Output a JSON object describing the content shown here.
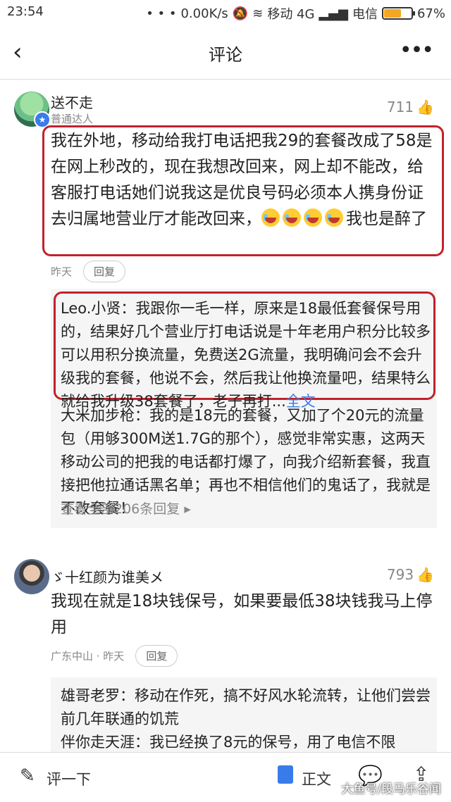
{
  "status": {
    "time": "23:54",
    "speed": "0.00K/s",
    "carrier1": "移动 4G",
    "carrier2": "电信",
    "battery": "67%",
    "battery_level": 0.67
  },
  "nav": {
    "title": "评论",
    "back_icon": "‹",
    "more_icon": "•••"
  },
  "comment1": {
    "user": "送不走",
    "level": "普通达人",
    "likes": "711",
    "text": "我在外地，移动给我打电话把我29的套餐改成了58是在网上秒改的，现在我想改回来，网上却不能改，给客服打电话她们说我这是优良号码必须本人携身份证去归属地营业厅才能改回来，",
    "text_end": "我也是醉了",
    "time": "昨天",
    "reply_label": "回复",
    "replies": [
      {
        "name": "Leo.小贤：",
        "text": "我跟你一毛一样，原来是18最低套餐保号用的，结果好几个营业厅打电话说是十年老用户积分比较多可以用积分换流量，免费送2G流量，我明确问会不会升级我的套餐，他说不会，然后我让他换流量吧，结果特么就给我升级38套餐了，老子再打...",
        "full": "全文"
      },
      {
        "name": "大米加步枪：",
        "text": "我的是18元的套餐，又加了个20元的流量包（用够300M送1.7G的那个），感觉非常实惠，这两天移动公司的把我的电话都打爆了，向我介绍新套餐，我直接把他拉通话黑名单；再也不相信他们的鬼话了，我就是不改套餐！"
      }
    ],
    "view_all": "查看全部206条回复"
  },
  "comment2": {
    "user": "ゞ十红颜为谁美メ",
    "likes": "793",
    "text": "我现在就是18块钱保号，如果要最低38块钱我马上停用",
    "location": "广东中山 · 昨天",
    "reply_label": "回复",
    "replies": [
      {
        "name": "雄哥老罗：",
        "text": "移动在作死，搞不好风水轮流转，让他们尝尝前几年联通的饥荒"
      },
      {
        "name": "伴你走天涯：",
        "text": "我已经换了8元的保号，用了电信不限"
      }
    ]
  },
  "bottom": {
    "write": "评一下",
    "body": "正文",
    "watermark": "大鱼号/段马乐谷闻"
  }
}
